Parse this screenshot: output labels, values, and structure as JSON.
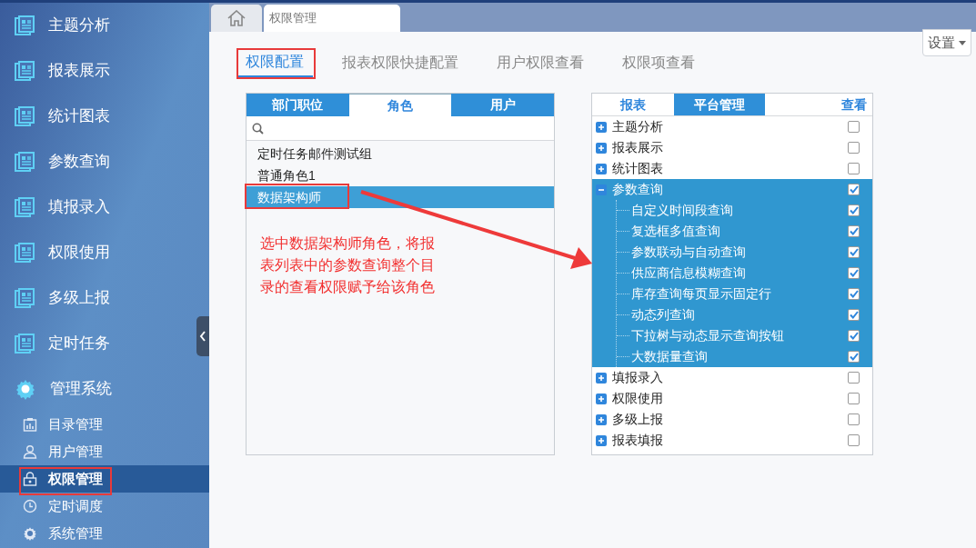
{
  "sidebar": {
    "items": [
      {
        "label": "主题分析",
        "kind": "report"
      },
      {
        "label": "报表展示",
        "kind": "report"
      },
      {
        "label": "统计图表",
        "kind": "report"
      },
      {
        "label": "参数查询",
        "kind": "report"
      },
      {
        "label": "填报录入",
        "kind": "report"
      },
      {
        "label": "权限使用",
        "kind": "report"
      },
      {
        "label": "多级上报",
        "kind": "report"
      },
      {
        "label": "定时任务",
        "kind": "report"
      },
      {
        "label": "管理系统",
        "kind": "gear"
      }
    ],
    "subitems": [
      {
        "label": "目录管理",
        "kind": "catalog",
        "selected": false
      },
      {
        "label": "用户管理",
        "kind": "user",
        "selected": false
      },
      {
        "label": "权限管理",
        "kind": "lock",
        "selected": true
      },
      {
        "label": "定时调度",
        "kind": "clock",
        "selected": false
      },
      {
        "label": "系统管理",
        "kind": "gear",
        "selected": false
      }
    ]
  },
  "top_tabs": [
    {
      "kind": "home",
      "selected": false
    },
    {
      "kind": "page",
      "label": "权限管理",
      "selected": true
    }
  ],
  "settings_button": "设置",
  "tabs": [
    {
      "label": "权限配置",
      "selected": true
    },
    {
      "label": "报表权限快捷配置",
      "selected": false
    },
    {
      "label": "用户权限查看",
      "selected": false
    },
    {
      "label": "权限项查看",
      "selected": false
    }
  ],
  "left_panel": {
    "tabs": [
      {
        "label": "部门职位",
        "selected": false
      },
      {
        "label": "角色",
        "selected": true
      },
      {
        "label": "用户",
        "selected": false
      }
    ],
    "roles": [
      {
        "label": "定时任务邮件测试组",
        "selected": false
      },
      {
        "label": "普通角色1",
        "selected": false
      },
      {
        "label": "数据架构师",
        "selected": true
      }
    ]
  },
  "right_panel": {
    "tabs": [
      {
        "label": "报表",
        "selected": true
      },
      {
        "label": "平台管理",
        "selected": false
      }
    ],
    "column": "查看",
    "tree": [
      {
        "label": "主题分析",
        "expanded": false,
        "checked": false,
        "selected": false
      },
      {
        "label": "报表展示",
        "expanded": false,
        "checked": false,
        "selected": false
      },
      {
        "label": "统计图表",
        "expanded": false,
        "checked": false,
        "selected": false
      },
      {
        "label": "参数查询",
        "expanded": true,
        "checked": true,
        "selected": true,
        "children": [
          {
            "label": "自定义时间段查询",
            "checked": true
          },
          {
            "label": "复选框多值查询",
            "checked": true
          },
          {
            "label": "参数联动与自动查询",
            "checked": true
          },
          {
            "label": "供应商信息模糊查询",
            "checked": true
          },
          {
            "label": "库存查询每页显示固定行",
            "checked": true
          },
          {
            "label": "动态列查询",
            "checked": true
          },
          {
            "label": "下拉树与动态显示查询按钮",
            "checked": true
          },
          {
            "label": "大数据量查询",
            "checked": true
          }
        ]
      },
      {
        "label": "填报录入",
        "expanded": false,
        "checked": false,
        "selected": false
      },
      {
        "label": "权限使用",
        "expanded": false,
        "checked": false,
        "selected": false
      },
      {
        "label": "多级上报",
        "expanded": false,
        "checked": false,
        "selected": false
      },
      {
        "label": "报表填报",
        "expanded": false,
        "checked": false,
        "selected": false
      }
    ]
  },
  "annotation": "选中数据架构师角色，将报表列表中的参数查询整个目录的查看权限赋予给该角色"
}
